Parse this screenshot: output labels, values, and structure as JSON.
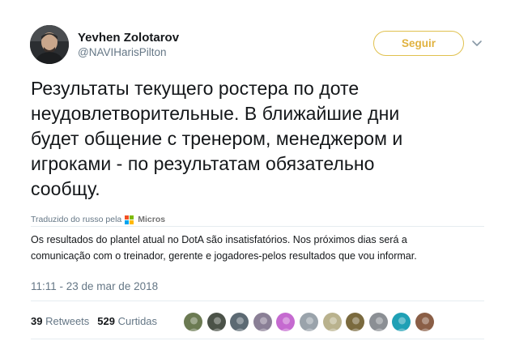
{
  "author": {
    "display_name": "Yevhen Zolotarov",
    "handle": "@NAVIHarisPilton",
    "avatar_icon": "profile-photo"
  },
  "follow_button": {
    "label": "Seguir",
    "color": "#e0b23f"
  },
  "more_icon": "chevron-down-icon",
  "tweet": {
    "lines": [
      "Результаты текущего ростера по доте",
      "неудовлетворительные. В ближайшие дни",
      "будет общение с тренером, менеджером и",
      "игроками - по результатам обязательно",
      "сообщу."
    ]
  },
  "translation": {
    "attribution": "Traduzido do russo pela",
    "provider": "Micros",
    "lines": [
      "Os resultados do plantel atual no DotA são insatisfatórios. Nos próximos dias será a",
      "comunicação com o treinador, gerente e jogadores-pelos resultados que vou informar."
    ]
  },
  "timestamp": "11:11 - 23 de mar de 2018",
  "stats": {
    "retweets_count": "39",
    "retweets_label": "Retweets",
    "likes_count": "529",
    "likes_label": "Curtidas"
  },
  "likers": [
    {
      "name": "liker-avatar-1",
      "color": "#6b7a52"
    },
    {
      "name": "liker-avatar-2",
      "color": "#4b5248"
    },
    {
      "name": "liker-avatar-3",
      "color": "#5c6a73"
    },
    {
      "name": "liker-avatar-4",
      "color": "#8a7f96"
    },
    {
      "name": "liker-avatar-5",
      "color": "#c56ad0"
    },
    {
      "name": "liker-avatar-6",
      "color": "#9aa3ab"
    },
    {
      "name": "liker-avatar-7",
      "color": "#b9b28d"
    },
    {
      "name": "liker-avatar-8",
      "color": "#7a6a3e"
    },
    {
      "name": "liker-avatar-9",
      "color": "#8b8f94"
    },
    {
      "name": "liker-avatar-10",
      "color": "#1fa0b5"
    },
    {
      "name": "liker-avatar-11",
      "color": "#8a5e46"
    }
  ]
}
